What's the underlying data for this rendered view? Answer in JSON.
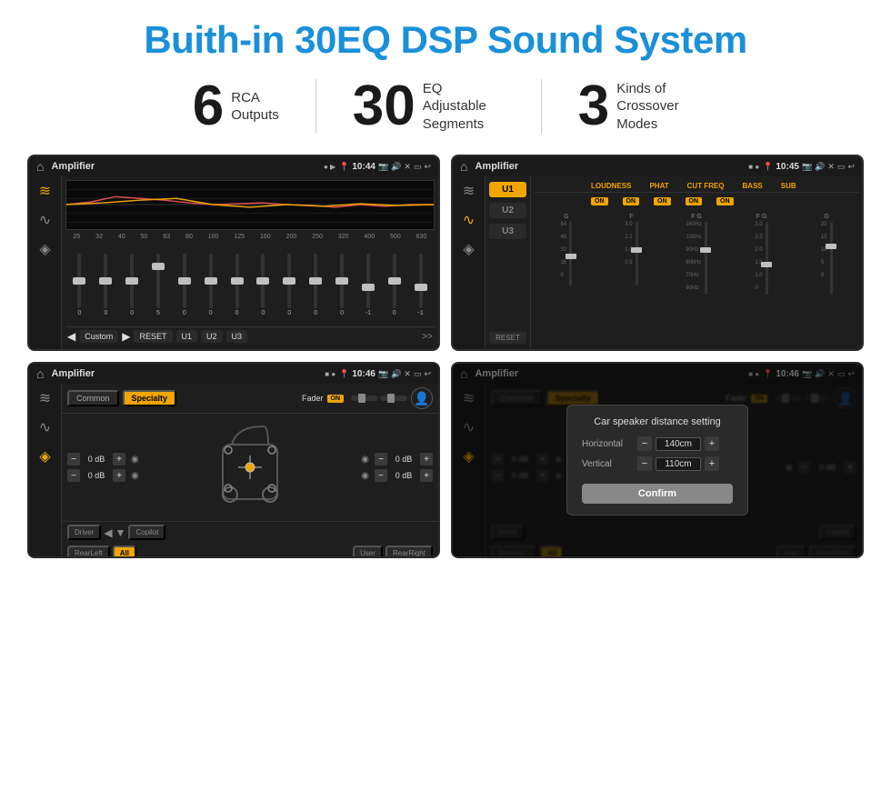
{
  "title": "Buith-in 30EQ DSP Sound System",
  "stats": [
    {
      "number": "6",
      "label": "RCA\nOutputs"
    },
    {
      "number": "30",
      "label": "EQ Adjustable\nSegments"
    },
    {
      "number": "3",
      "label": "Kinds of\nCrossover Modes"
    }
  ],
  "screens": [
    {
      "id": "eq-screen",
      "time": "10:44",
      "app_title": "Amplifier",
      "freqs": [
        "25",
        "32",
        "40",
        "50",
        "63",
        "80",
        "100",
        "125",
        "160",
        "200",
        "250",
        "320",
        "400",
        "500",
        "630"
      ],
      "values": [
        "0",
        "0",
        "0",
        "5",
        "0",
        "0",
        "0",
        "0",
        "0",
        "0",
        "0",
        "-1",
        "0",
        "-1"
      ],
      "eq_presets": [
        "Custom",
        "RESET",
        "U1",
        "U2",
        "U3"
      ]
    },
    {
      "id": "crossover-screen",
      "time": "10:45",
      "app_title": "Amplifier",
      "channels": [
        "U1",
        "U2",
        "U3"
      ],
      "params": [
        "LOUDNESS",
        "PHAT",
        "CUT FREQ",
        "BASS",
        "SUB"
      ]
    },
    {
      "id": "fader-screen",
      "time": "10:46",
      "app_title": "Amplifier",
      "tabs": [
        "Common",
        "Specialty"
      ],
      "fader_label": "Fader",
      "fader_on": "ON",
      "db_values": [
        "0 dB",
        "0 dB",
        "0 dB",
        "0 dB"
      ],
      "positions": [
        "Driver",
        "RearLeft",
        "All",
        "User",
        "RearRight",
        "Copilot"
      ]
    },
    {
      "id": "dialog-screen",
      "time": "10:46",
      "app_title": "Amplifier",
      "dialog": {
        "title": "Car speaker distance setting",
        "horizontal_label": "Horizontal",
        "horizontal_value": "140cm",
        "vertical_label": "Vertical",
        "vertical_value": "110cm",
        "confirm_label": "Confirm"
      },
      "db_values": [
        "0 dB",
        "0 dB"
      ],
      "positions": [
        "Driver",
        "RearLeft",
        "All",
        "User",
        "RearRight",
        "Copilot"
      ]
    }
  ],
  "icons": {
    "home": "⌂",
    "location": "📍",
    "volume": "🔊",
    "eq_icon": "≡",
    "back": "↩",
    "user": "👤",
    "play": "▶",
    "pause": "◀",
    "settings": "⚙",
    "fullscreen": "⊡",
    "minus": "−",
    "plus": "+"
  }
}
